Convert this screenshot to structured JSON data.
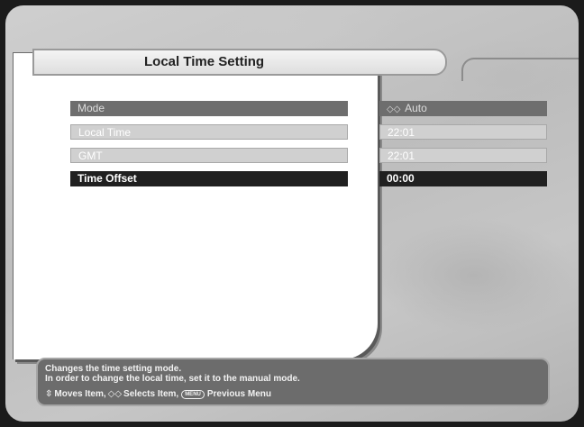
{
  "title": "Local Time Setting",
  "settings": [
    {
      "label": "Mode",
      "value": "Auto",
      "state": "normal"
    },
    {
      "label": "Local Time",
      "value": "22:01",
      "state": "disabled"
    },
    {
      "label": "GMT",
      "value": "22:01",
      "state": "disabled"
    },
    {
      "label": "Time Offset",
      "value": "00:00",
      "state": "selected"
    }
  ],
  "help": {
    "line1": "Changes the time setting mode.",
    "line2": "In order to change the local time, set it to the manual mode."
  },
  "hints": {
    "move_label": "Moves Item,",
    "select_label": "Selects Item,",
    "menu_key": "MENU",
    "previous_label": "Previous Menu"
  },
  "icons": {
    "updown": "updown-arrows-icon",
    "leftright": "leftright-arrows-icon",
    "menu": "menu-key-icon"
  }
}
